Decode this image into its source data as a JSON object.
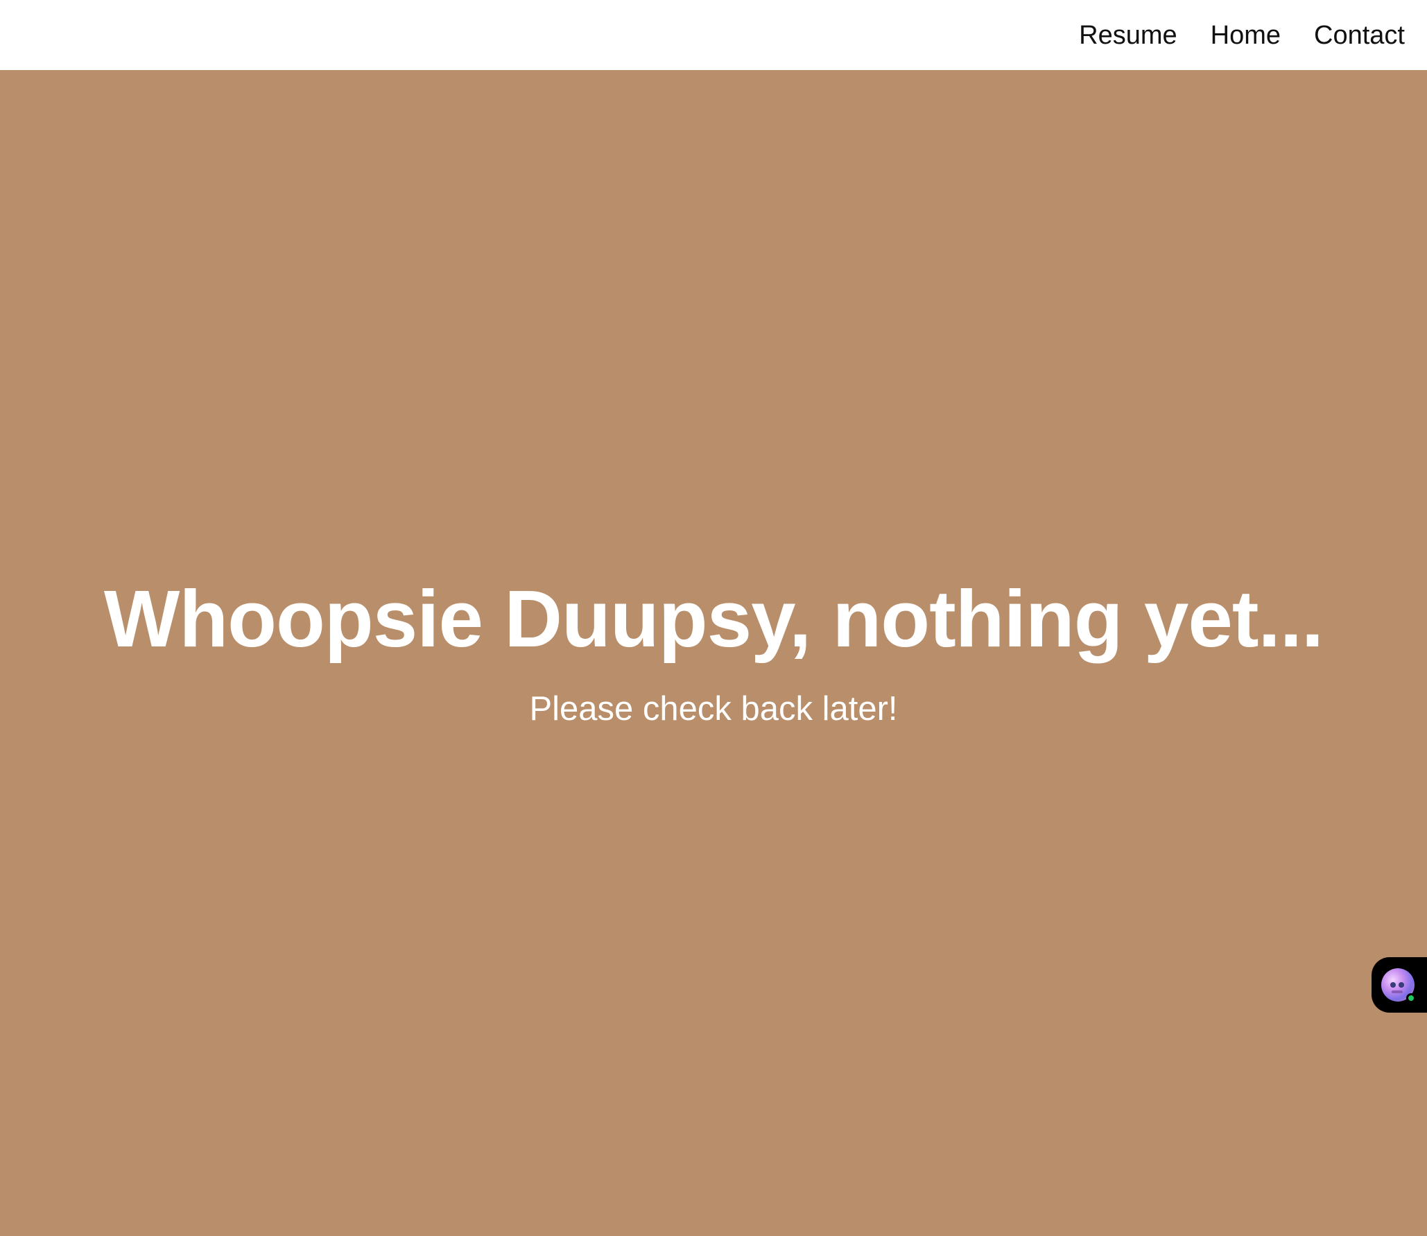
{
  "nav": {
    "items": [
      {
        "label": "Resume"
      },
      {
        "label": "Home"
      },
      {
        "label": "Contact"
      }
    ]
  },
  "hero": {
    "headline": "Whoopsie Duupsy, nothing yet...",
    "subline": "Please check back later!",
    "background_color": "#b98e6a",
    "text_color": "#ffffff"
  },
  "chat_widget": {
    "icon": "avatar-icon",
    "status": "online",
    "status_color": "#22c55e"
  }
}
